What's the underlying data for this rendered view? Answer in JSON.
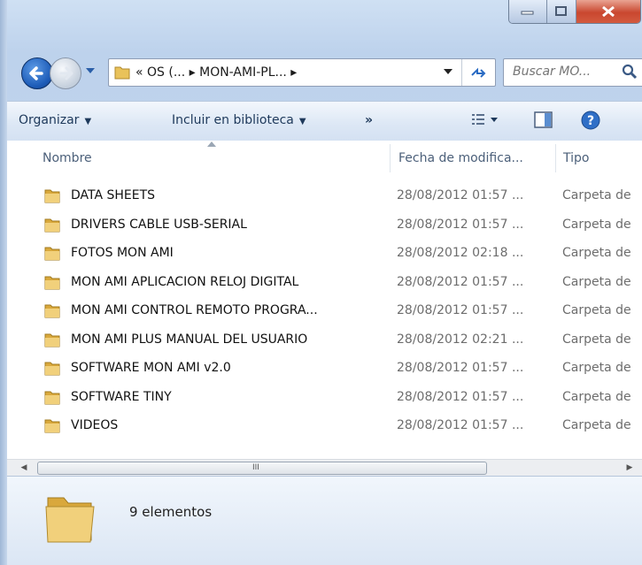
{
  "window": {
    "address_path": "« OS (...  ▸  MON-AMI-PL...  ▸",
    "search_placeholder": "Buscar MO...",
    "caption": {
      "minimize": "–",
      "maximize": "▢",
      "close": "X"
    }
  },
  "toolbar": {
    "organize": "Organizar",
    "include_library": "Incluir en biblioteca",
    "more": "»"
  },
  "columns": {
    "name": "Nombre",
    "date": "Fecha de modifica...",
    "type": "Tipo"
  },
  "files": [
    {
      "name": "DATA SHEETS",
      "date": "28/08/2012 01:57 ...",
      "type": "Carpeta de"
    },
    {
      "name": "DRIVERS CABLE USB-SERIAL",
      "date": "28/08/2012 01:57 ...",
      "type": "Carpeta de"
    },
    {
      "name": "FOTOS MON AMI",
      "date": "28/08/2012 02:18 ...",
      "type": "Carpeta de"
    },
    {
      "name": "MON AMI APLICACION RELOJ DIGITAL",
      "date": "28/08/2012 01:57 ...",
      "type": "Carpeta de"
    },
    {
      "name": "MON AMI CONTROL REMOTO PROGRA...",
      "date": "28/08/2012 01:57 ...",
      "type": "Carpeta de"
    },
    {
      "name": "MON AMI PLUS MANUAL DEL USUARIO",
      "date": "28/08/2012 02:21 ...",
      "type": "Carpeta de"
    },
    {
      "name": "SOFTWARE MON AMI v2.0",
      "date": "28/08/2012 01:57 ...",
      "type": "Carpeta de"
    },
    {
      "name": "SOFTWARE TINY",
      "date": "28/08/2012 01:57 ...",
      "type": "Carpeta de"
    },
    {
      "name": "VIDEOS",
      "date": "28/08/2012 01:57 ...",
      "type": "Carpeta de"
    }
  ],
  "scrollbar": {
    "grip": "III"
  },
  "status": {
    "count_text": "9 elementos"
  },
  "colors": {
    "folder": "#e9c25a",
    "accent": "#1e395b",
    "window_chrome": "#bdd2ec"
  }
}
